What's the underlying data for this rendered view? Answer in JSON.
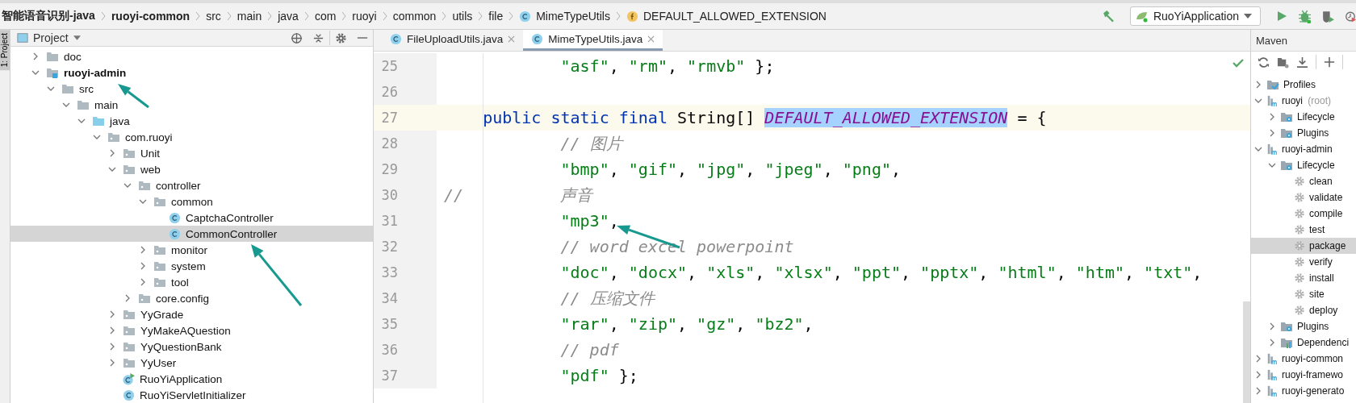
{
  "breadcrumbs": [
    {
      "label": "智能语音识别-java",
      "kind": "project"
    },
    {
      "label": "ruoyi-common",
      "kind": "module"
    },
    {
      "label": "src",
      "kind": "folder"
    },
    {
      "label": "main",
      "kind": "folder"
    },
    {
      "label": "java",
      "kind": "folder"
    },
    {
      "label": "com",
      "kind": "folder"
    },
    {
      "label": "ruoyi",
      "kind": "folder"
    },
    {
      "label": "common",
      "kind": "folder"
    },
    {
      "label": "utils",
      "kind": "folder"
    },
    {
      "label": "file",
      "kind": "folder"
    },
    {
      "label": "MimeTypeUtils",
      "kind": "class"
    },
    {
      "label": "DEFAULT_ALLOWED_EXTENSION",
      "kind": "field"
    }
  ],
  "run_toolbar": {
    "configuration": "RuoYiApplication"
  },
  "side_tab": "1: Project",
  "project_panel": {
    "title": "Project",
    "tree": [
      {
        "name": "doc",
        "kind": "folder",
        "expanded": false,
        "selected": false
      },
      {
        "name": "ruoyi-admin",
        "kind": "module",
        "expanded": true,
        "selected": false,
        "children": [
          {
            "name": "src",
            "kind": "folder",
            "expanded": true,
            "selected": false,
            "children": [
              {
                "name": "main",
                "kind": "folder",
                "expanded": true,
                "selected": false,
                "children": [
                  {
                    "name": "java",
                    "kind": "source",
                    "expanded": true,
                    "selected": false,
                    "children": [
                      {
                        "name": "com.ruoyi",
                        "kind": "package",
                        "expanded": true,
                        "selected": false,
                        "children": [
                          {
                            "name": "Unit",
                            "kind": "package",
                            "expanded": false,
                            "selected": false
                          },
                          {
                            "name": "web",
                            "kind": "package",
                            "expanded": true,
                            "selected": false,
                            "children": [
                              {
                                "name": "controller",
                                "kind": "package",
                                "expanded": true,
                                "selected": false,
                                "children": [
                                  {
                                    "name": "common",
                                    "kind": "package",
                                    "expanded": true,
                                    "selected": false,
                                    "children": [
                                      {
                                        "name": "CaptchaController",
                                        "kind": "class",
                                        "selected": false
                                      },
                                      {
                                        "name": "CommonController",
                                        "kind": "class",
                                        "selected": true
                                      }
                                    ]
                                  },
                                  {
                                    "name": "monitor",
                                    "kind": "package",
                                    "expanded": false,
                                    "selected": false
                                  },
                                  {
                                    "name": "system",
                                    "kind": "package",
                                    "expanded": false,
                                    "selected": false
                                  },
                                  {
                                    "name": "tool",
                                    "kind": "package",
                                    "expanded": false,
                                    "selected": false
                                  }
                                ]
                              },
                              {
                                "name": "core.config",
                                "kind": "package",
                                "expanded": false,
                                "selected": false
                              }
                            ]
                          },
                          {
                            "name": "YyGrade",
                            "kind": "package",
                            "expanded": false,
                            "selected": false
                          },
                          {
                            "name": "YyMakeAQuestion",
                            "kind": "package",
                            "expanded": false,
                            "selected": false
                          },
                          {
                            "name": "YyQuestionBank",
                            "kind": "package",
                            "expanded": false,
                            "selected": false
                          },
                          {
                            "name": "YyUser",
                            "kind": "package",
                            "expanded": false,
                            "selected": false
                          },
                          {
                            "name": "RuoYiApplication",
                            "kind": "app-class",
                            "selected": false
                          },
                          {
                            "name": "RuoYiServletInitializer",
                            "kind": "class",
                            "selected": false
                          }
                        ]
                      }
                    ]
                  }
                ]
              }
            ]
          }
        ]
      }
    ]
  },
  "editor": {
    "tabs": [
      {
        "label": "FileUploadUtils.java",
        "selected": false
      },
      {
        "label": "MimeTypeUtils.java",
        "selected": true
      }
    ],
    "lines": [
      {
        "number": "25",
        "current": false,
        "tokens": [
          {
            "kind": "string",
            "text": "            \"asf\""
          },
          {
            "kind": "code",
            "text": ", "
          },
          {
            "kind": "string",
            "text": "\"rm\""
          },
          {
            "kind": "code",
            "text": ", "
          },
          {
            "kind": "string",
            "text": "\"rmvb\""
          },
          {
            "kind": "code",
            "text": " };"
          }
        ]
      },
      {
        "number": "26",
        "current": false
      },
      {
        "number": "27",
        "current": true,
        "tokens": [
          {
            "kind": "keyword",
            "text": "    public static final"
          },
          {
            "kind": "code",
            "text": " String[] "
          },
          {
            "kind": "selection",
            "text": "DEFAULT_ALLOWED_EXTENSION"
          },
          {
            "kind": "code",
            "text": " = {"
          }
        ]
      },
      {
        "number": "28",
        "current": false,
        "tokens": [
          {
            "kind": "comment",
            "text": "            // 图片"
          }
        ]
      },
      {
        "number": "29",
        "current": false,
        "tokens": [
          {
            "kind": "string",
            "text": "            \"bmp\""
          },
          {
            "kind": "code",
            "text": ", "
          },
          {
            "kind": "string",
            "text": "\"gif\""
          },
          {
            "kind": "code",
            "text": ", "
          },
          {
            "kind": "string",
            "text": "\"jpg\""
          },
          {
            "kind": "code",
            "text": ", "
          },
          {
            "kind": "string",
            "text": "\"jpeg\""
          },
          {
            "kind": "code",
            "text": ", "
          },
          {
            "kind": "string",
            "text": "\"png\""
          },
          {
            "kind": "code",
            "text": ","
          }
        ]
      },
      {
        "number": "30",
        "current": false,
        "tokens": [
          {
            "kind": "comment",
            "text": "//          声音"
          }
        ]
      },
      {
        "number": "31",
        "current": false,
        "tokens": [
          {
            "kind": "string",
            "text": "            \"mp3\""
          },
          {
            "kind": "code",
            "text": ","
          }
        ]
      },
      {
        "number": "32",
        "current": false,
        "tokens": [
          {
            "kind": "comment",
            "text": "            // word excel powerpoint"
          }
        ]
      },
      {
        "number": "33",
        "current": false,
        "tokens": [
          {
            "kind": "string",
            "text": "            \"doc\""
          },
          {
            "kind": "code",
            "text": ", "
          },
          {
            "kind": "string",
            "text": "\"docx\""
          },
          {
            "kind": "code",
            "text": ", "
          },
          {
            "kind": "string",
            "text": "\"xls\""
          },
          {
            "kind": "code",
            "text": ", "
          },
          {
            "kind": "string",
            "text": "\"xlsx\""
          },
          {
            "kind": "code",
            "text": ", "
          },
          {
            "kind": "string",
            "text": "\"ppt\""
          },
          {
            "kind": "code",
            "text": ", "
          },
          {
            "kind": "string",
            "text": "\"pptx\""
          },
          {
            "kind": "code",
            "text": ", "
          },
          {
            "kind": "string",
            "text": "\"html\""
          },
          {
            "kind": "code",
            "text": ", "
          },
          {
            "kind": "string",
            "text": "\"htm\""
          },
          {
            "kind": "code",
            "text": ", "
          },
          {
            "kind": "string",
            "text": "\"txt\""
          },
          {
            "kind": "code",
            "text": ","
          }
        ]
      },
      {
        "number": "34",
        "current": false,
        "tokens": [
          {
            "kind": "comment",
            "text": "            // 压缩文件"
          }
        ]
      },
      {
        "number": "35",
        "current": false,
        "tokens": [
          {
            "kind": "string",
            "text": "            \"rar\""
          },
          {
            "kind": "code",
            "text": ", "
          },
          {
            "kind": "string",
            "text": "\"zip\""
          },
          {
            "kind": "code",
            "text": ", "
          },
          {
            "kind": "string",
            "text": "\"gz\""
          },
          {
            "kind": "code",
            "text": ", "
          },
          {
            "kind": "string",
            "text": "\"bz2\""
          },
          {
            "kind": "code",
            "text": ","
          }
        ]
      },
      {
        "number": "36",
        "current": false,
        "tokens": [
          {
            "kind": "comment",
            "text": "            // pdf"
          }
        ]
      },
      {
        "number": "37",
        "current": false,
        "tokens": [
          {
            "kind": "string",
            "text": "            \"pdf\""
          },
          {
            "kind": "code",
            "text": " };"
          }
        ]
      }
    ]
  },
  "maven_panel": {
    "title": "Maven",
    "tree": [
      {
        "name": "Profiles",
        "kind": "profiles",
        "expanded": false,
        "selected": false
      },
      {
        "name": "ruoyi",
        "note": "(root)",
        "kind": "module",
        "expanded": true,
        "selected": false,
        "children": [
          {
            "name": "Lifecycle",
            "kind": "lifecycle",
            "expanded": false,
            "selected": false
          },
          {
            "name": "Plugins",
            "kind": "plugins",
            "expanded": false,
            "selected": false
          }
        ]
      },
      {
        "name": "ruoyi-admin",
        "kind": "module",
        "expanded": true,
        "selected": false,
        "children": [
          {
            "name": "Lifecycle",
            "kind": "lifecycle",
            "expanded": true,
            "selected": false,
            "children": [
              {
                "name": "clean",
                "kind": "goal",
                "selected": false
              },
              {
                "name": "validate",
                "kind": "goal",
                "selected": false
              },
              {
                "name": "compile",
                "kind": "goal",
                "selected": false
              },
              {
                "name": "test",
                "kind": "goal",
                "selected": false
              },
              {
                "name": "package",
                "kind": "goal",
                "selected": true
              },
              {
                "name": "verify",
                "kind": "goal",
                "selected": false
              },
              {
                "name": "install",
                "kind": "goal",
                "selected": false
              },
              {
                "name": "site",
                "kind": "goal",
                "selected": false
              },
              {
                "name": "deploy",
                "kind": "goal",
                "selected": false
              }
            ]
          },
          {
            "name": "Plugins",
            "kind": "plugins",
            "expanded": false,
            "selected": false
          },
          {
            "name": "Dependenci",
            "kind": "dependencies",
            "expanded": false,
            "selected": false
          }
        ]
      },
      {
        "name": "ruoyi-common",
        "kind": "module",
        "expanded": false,
        "selected": false
      },
      {
        "name": "ruoyi-framewo",
        "kind": "module",
        "expanded": false,
        "selected": false
      },
      {
        "name": "ruoyi-generato",
        "kind": "module",
        "expanded": false,
        "selected": false
      }
    ]
  }
}
